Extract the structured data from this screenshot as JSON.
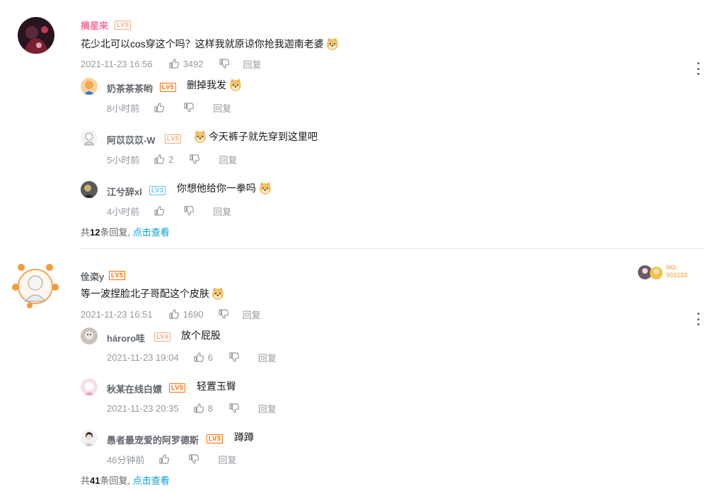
{
  "comments": [
    {
      "user": "摘星来",
      "level": "LV5",
      "text_before": "花少北可以cos穿这个吗？这样我就原谅你抢我迦南老婆",
      "emoji": "doge-emoji",
      "time": "2021-11-23 16:56",
      "likes": "3492",
      "reply_label": "回复",
      "replies": [
        {
          "user": "奶茶茶茶哟",
          "level": "LV5",
          "text": "删掉我发",
          "emoji_after": true,
          "time": "8小时前",
          "likes": "",
          "reply_label": "回复"
        },
        {
          "user": "阿苡苡苡-W",
          "level": "LV5",
          "text": "今天裤子就先穿到这里吧",
          "emoji_before": true,
          "time": "5小时前",
          "likes": "2",
          "reply_label": "回复"
        },
        {
          "user": "江兮辞xl",
          "level": "LV3",
          "text": "你想他给你一拳吗",
          "emoji_after": true,
          "time": "4小时前",
          "likes": "",
          "reply_label": "回复"
        }
      ],
      "summary_prefix": "共",
      "summary_count": "12",
      "summary_suffix": "条回复,",
      "summary_link": "点击查看"
    },
    {
      "user": "佺栥y",
      "level": "LV5",
      "text_before": "等一波捏脸北子哥配这个皮肤",
      "emoji": "doge-rose-emoji",
      "time": "2021-11-23 16:51",
      "likes": "1690",
      "reply_label": "回复",
      "badge_no": "NO.",
      "badge_num": "003133",
      "replies": [
        {
          "user": "hároro哇",
          "level": "LV4",
          "text": "放个屁股",
          "time": "2021-11-23 19:04",
          "likes": "6",
          "reply_label": "回复"
        },
        {
          "user": "秋某在线白嫖",
          "level": "LV5",
          "text": "轻置玉臀",
          "time": "2021-11-23 20:35",
          "likes": "8",
          "reply_label": "回复"
        },
        {
          "user": "愚者最宠爱的阿罗德斯",
          "level": "LV5",
          "text": "蹲蹲",
          "time": "46分钟前",
          "likes": "",
          "reply_label": "回复"
        }
      ],
      "summary_prefix": "共",
      "summary_count": "41",
      "summary_suffix": "条回复,",
      "summary_link": "点击查看"
    }
  ],
  "colors": {
    "username_vip": "#fb7299",
    "username": "#61666d",
    "level_orange": "#ff6c00",
    "link": "#00a1d6",
    "meta": "#9499a0"
  }
}
